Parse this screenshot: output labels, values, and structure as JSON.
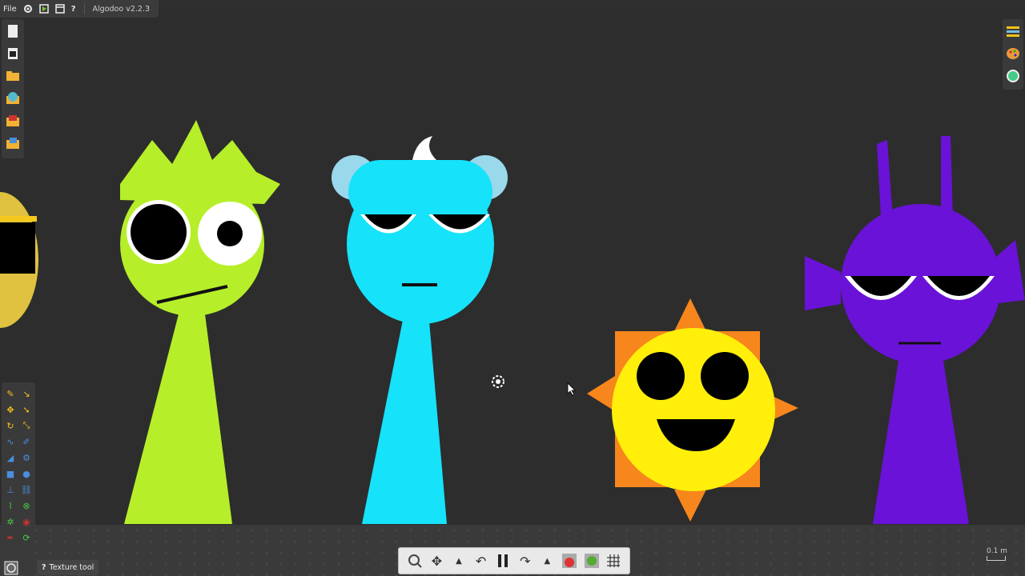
{
  "app": {
    "menu_file": "File",
    "title": "Algodoo v2.2.3"
  },
  "icons": {
    "settings": "gear-icon",
    "help": "help-icon"
  },
  "toolbar_tip": {
    "help_glyph": "?",
    "label": "Texture tool"
  },
  "scale": {
    "label": "0.1 m"
  },
  "colors": {
    "lime": "#b6ef2a",
    "cyan": "#16e2fa",
    "yellow": "#ffef0a",
    "orange": "#f7861d",
    "purple": "#6a12d8",
    "background": "#2d2d2d"
  }
}
